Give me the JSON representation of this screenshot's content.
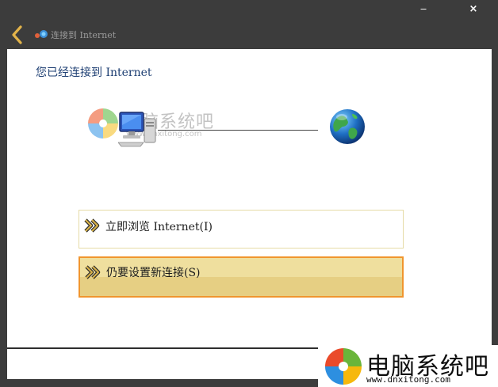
{
  "window": {
    "minimize_glyph": "‒",
    "close_glyph": "×",
    "title": "连接到 Internet",
    "back_icon": "back-arrow-icon",
    "title_icon": "network-wizard-icon"
  },
  "main": {
    "heading": "您已经连接到 Internet",
    "illustration": {
      "left_icon": "computer-icon",
      "right_icon": "globe-icon"
    },
    "options": [
      {
        "label": "立即浏览 Internet(I)",
        "icon": "double-chevron-right-icon"
      },
      {
        "label": "仍要设置新连接(S)",
        "icon": "double-chevron-right-icon"
      }
    ]
  },
  "watermark": {
    "name": "电脑系统吧",
    "url": "www.dnxitong.com"
  },
  "brand": {
    "name": "电脑系统吧",
    "url": "www.dnxitong.com"
  },
  "colors": {
    "window_frame": "#3c3c3c",
    "heading_text": "#1e3f73",
    "option_selected_fill": "#e6cf83",
    "option_selected_border": "#f0952e",
    "option_border": "#e6dba6",
    "arrow_gold": "#c9a640"
  }
}
